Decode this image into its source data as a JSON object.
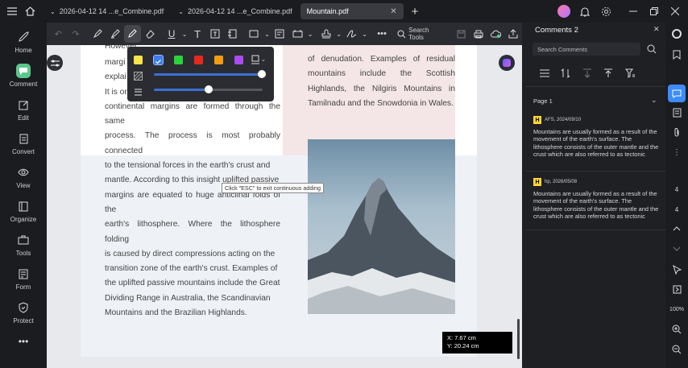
{
  "tabs": [
    {
      "label": "2026-04-12 14 ...e_Combine.pdf"
    },
    {
      "label": "2026-04-12 14 ...e_Combine.pdf"
    },
    {
      "label": "Mountain.pdf"
    }
  ],
  "nav": [
    {
      "label": "Home",
      "icon": "home-icon"
    },
    {
      "label": "Comment",
      "icon": "comment-icon"
    },
    {
      "label": "Edit",
      "icon": "edit-icon"
    },
    {
      "label": "Convert",
      "icon": "convert-icon"
    },
    {
      "label": "View",
      "icon": "view-icon"
    },
    {
      "label": "Organize",
      "icon": "organize-icon"
    },
    {
      "label": "Tools",
      "icon": "tools-icon"
    },
    {
      "label": "Form",
      "icon": "form-icon"
    },
    {
      "label": "Protect",
      "icon": "protect-icon"
    }
  ],
  "toolbar": {
    "search_label": "Search Tools"
  },
  "document": {
    "left_lines": [
      "However",
      "margi",
      "explai",
      "It is or",
      "continental margins are formed through the same",
      "process. The process is most probably connected",
      "to the tensional forces in the earth's crust and",
      "mantle. According to this insight uplifted passive",
      "margins are equated to huge anticlinal folds of the",
      "earth's lithosphere. Where the lithosphere folding",
      "is caused by direct compressions acting on the",
      "transition zone of the earth's crust. Examples of",
      "the uplifted passive mountains include the Great",
      "Dividing Range in Australia, the Scandinavian",
      "Mountains and the Brazilian Highlands."
    ],
    "right_text": "of denudation. Examples of residual mountains include the Scottish Highlands, the Nilgiris Mountains in Tamilnadu and the Snowdonia in Wales.",
    "tooltip": "Click \"ESC\" to exit continuous adding",
    "coords": {
      "x": "X: 7.67 cm",
      "y": "Y: 20.24 cm"
    }
  },
  "popup": {
    "colors": [
      "#f7e34a",
      "#3d7cf0",
      "#2bd23b",
      "#e8281e",
      "#f39c12",
      "#a94cf0"
    ],
    "selected_color_index": 1,
    "opacity_value": 1.0,
    "thickness_value": 0.5
  },
  "comments": {
    "title": "Comments 2",
    "search_placeholder": "Search Comments",
    "page_header": "Page 1",
    "items": [
      {
        "author": "AFS, 2024/09/10",
        "text": "Mountains are usually formed as a result of the movement of the earth's surface. The lithosphere consists of the outer mantle and the crust which are also referred to as tectonic plates. The geological process of m..."
      },
      {
        "author": "hp, 2026/05/08",
        "text": "Mountains are usually formed as a result of the movement of the earth's surface. The lithosphere consists of the outer mantle and the crust which are also referred to as tectonic plates. The geological process of m..."
      }
    ]
  },
  "rightbar": {
    "page_current": "4",
    "page_total": "4",
    "zoom": "100%"
  }
}
